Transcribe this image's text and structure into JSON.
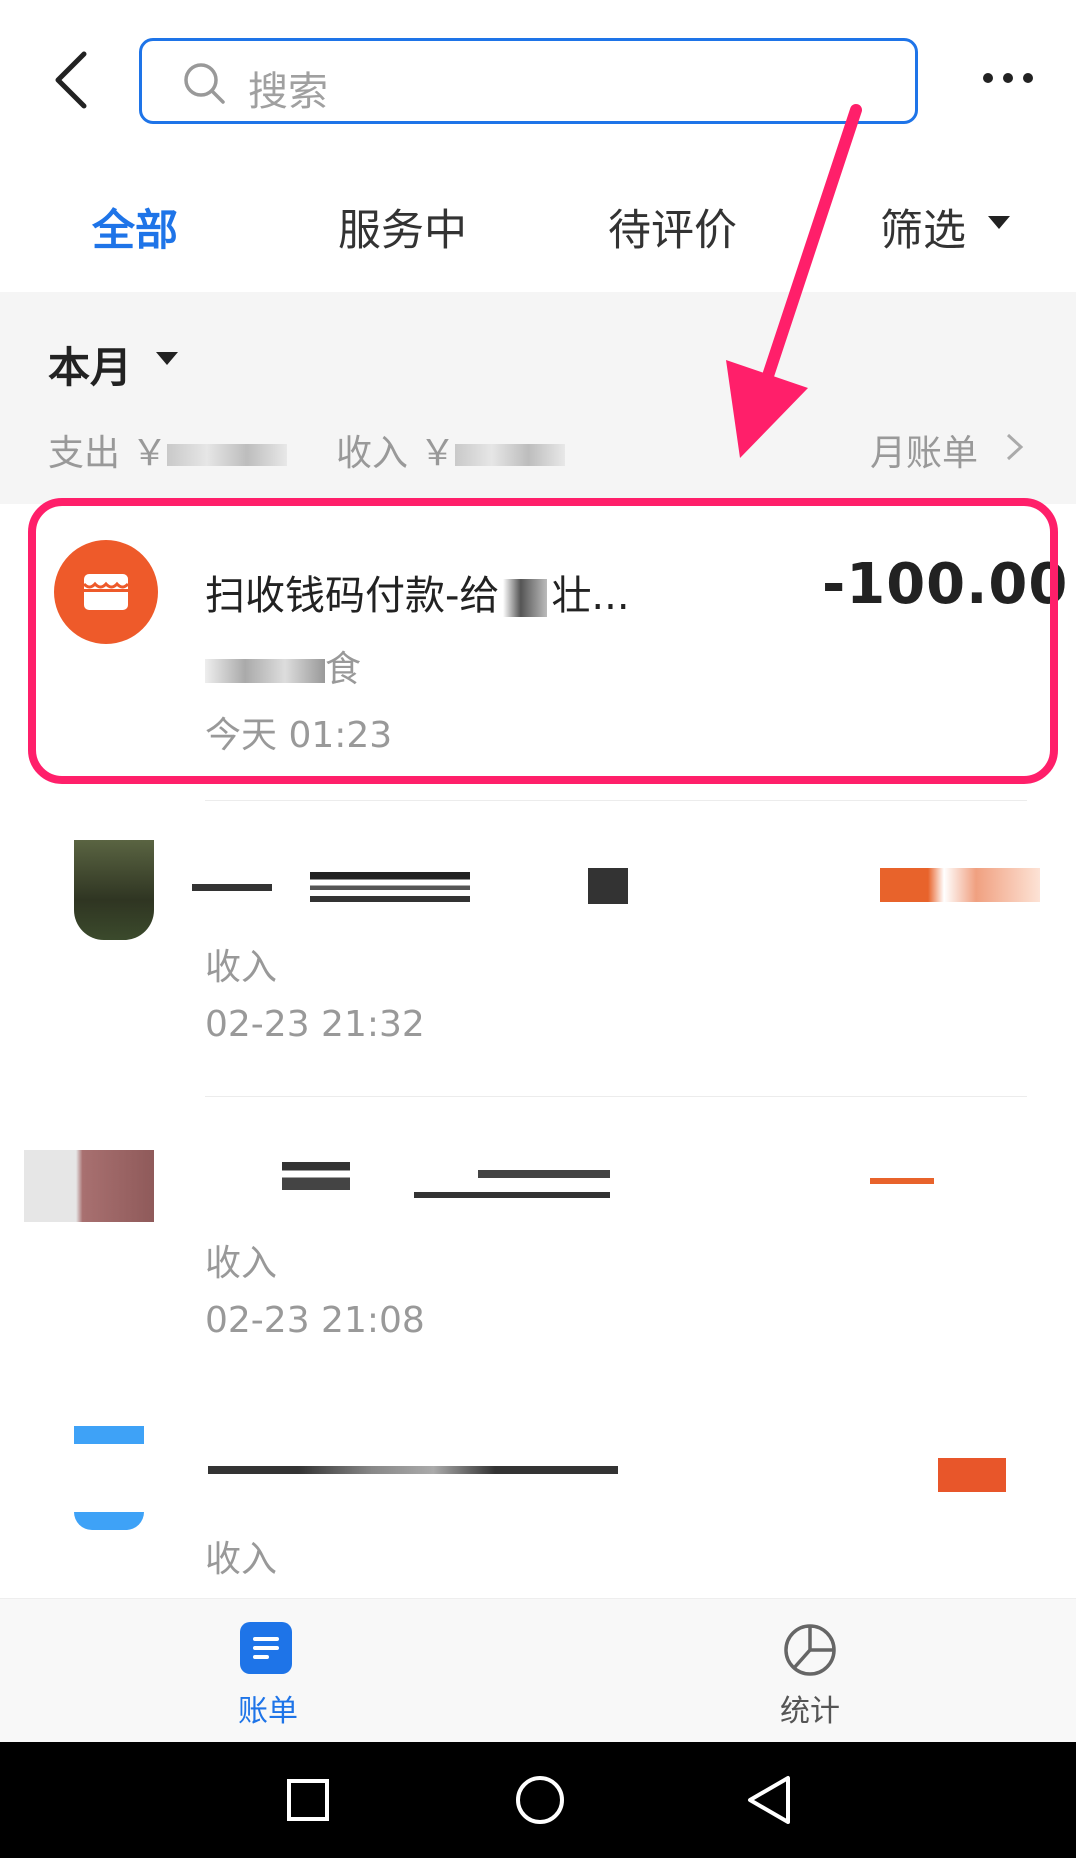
{
  "header": {
    "search_placeholder": "搜索",
    "back_icon": "chevron-left-icon",
    "more_icon": "more-dots-icon"
  },
  "tabs": [
    {
      "label": "全部",
      "active": true
    },
    {
      "label": "服务中",
      "active": false
    },
    {
      "label": "待评价",
      "active": false
    },
    {
      "label": "筛选",
      "active": false
    }
  ],
  "summary": {
    "period": "本月",
    "expense_label": "支出 ￥",
    "income_label": "收入 ￥",
    "monthly_bill": "月账单"
  },
  "records": [
    {
      "title": "扫收钱码付款-给",
      "title_tail": "壮...",
      "subtitle_tail": "食",
      "time": "今天  01:23",
      "amount": "-100.00",
      "highlighted": true
    },
    {
      "title": "",
      "subtitle": "收入",
      "time": "02-23  21:32",
      "amount": ""
    },
    {
      "title": "",
      "subtitle": "收入",
      "time": "02-23  21:08",
      "amount": ""
    },
    {
      "title": "",
      "subtitle": "收入",
      "time": "",
      "amount": ""
    }
  ],
  "bottom_nav": [
    {
      "label": "账单",
      "icon": "bill-icon",
      "active": true
    },
    {
      "label": "统计",
      "icon": "pie-chart-icon",
      "active": false
    }
  ],
  "colors": {
    "accent": "#1e74e8",
    "highlight": "#ff1f6a",
    "shop_icon": "#ee5a2a",
    "income_amount": "#e8632b"
  }
}
